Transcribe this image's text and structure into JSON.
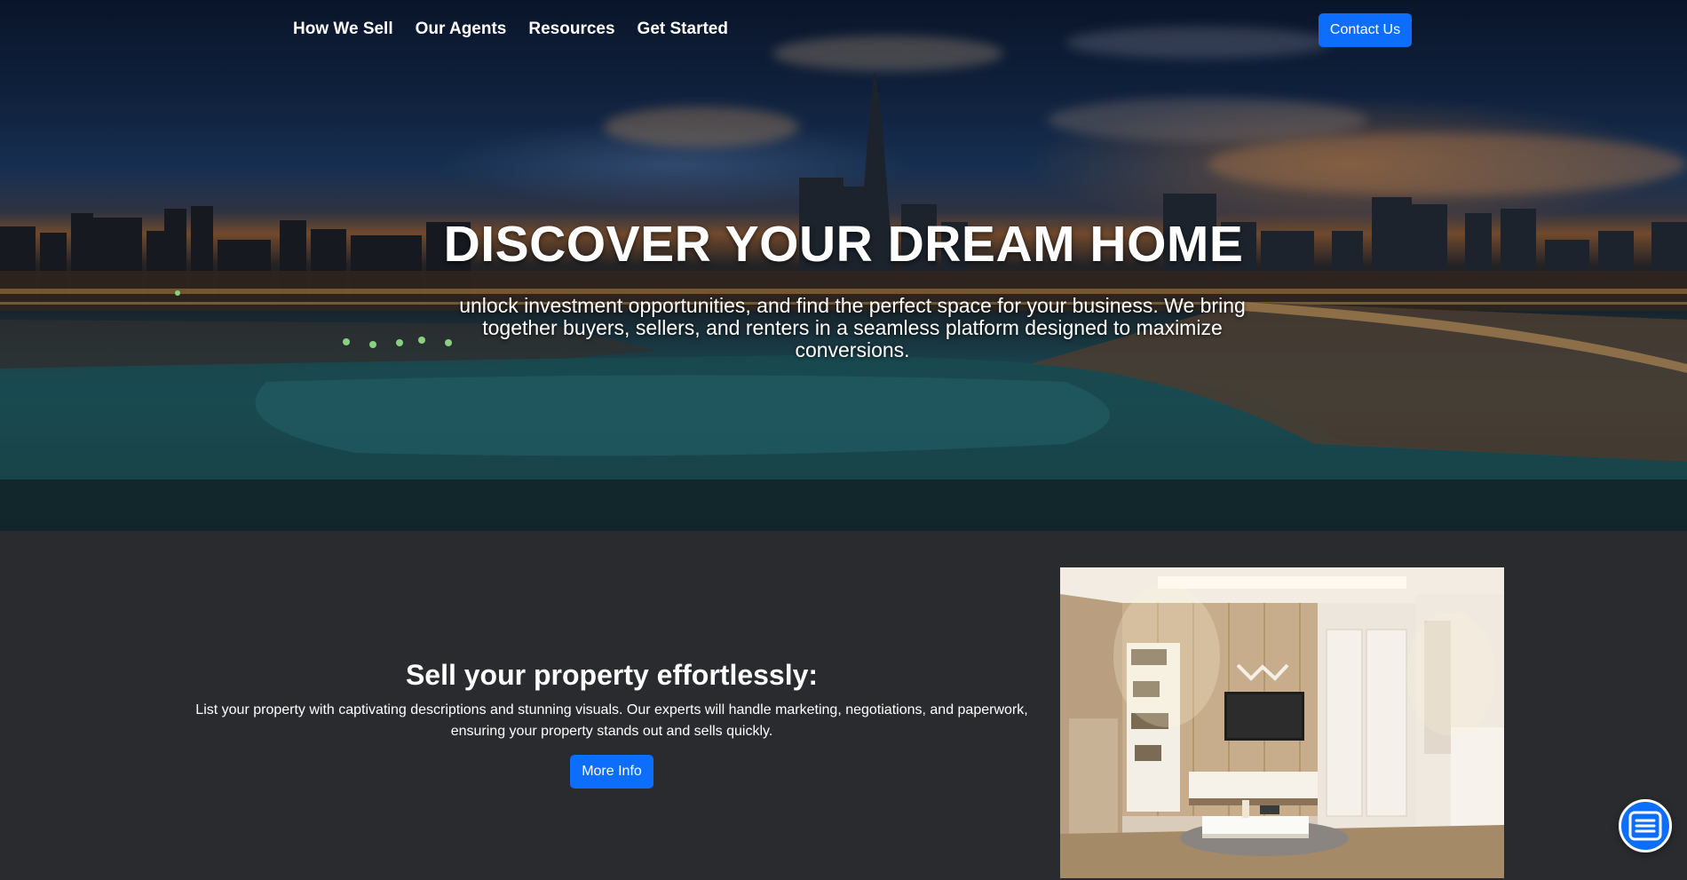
{
  "nav": {
    "items": [
      {
        "label": "How We Sell"
      },
      {
        "label": "Our Agents"
      },
      {
        "label": "Resources"
      },
      {
        "label": "Get Started"
      }
    ],
    "contact_label": "Contact Us"
  },
  "hero": {
    "title": "DISCOVER YOUR DREAM HOME",
    "subtitle": "unlock investment opportunities, and find the perfect space for your business. We bring together buyers, sellers, and renters in a seamless platform designed to maximize conversions."
  },
  "sell": {
    "title": "Sell your property effortlessly:",
    "description": "List your property with captivating descriptions and stunning visuals. Our experts will handle marketing, negotiations, and paperwork, ensuring your property stands out and sells quickly.",
    "button_label": "More Info"
  },
  "icons": {
    "chat": "list-menu-icon"
  },
  "colors": {
    "accent": "#0d6efd",
    "section_bg": "#2a2b2e"
  }
}
